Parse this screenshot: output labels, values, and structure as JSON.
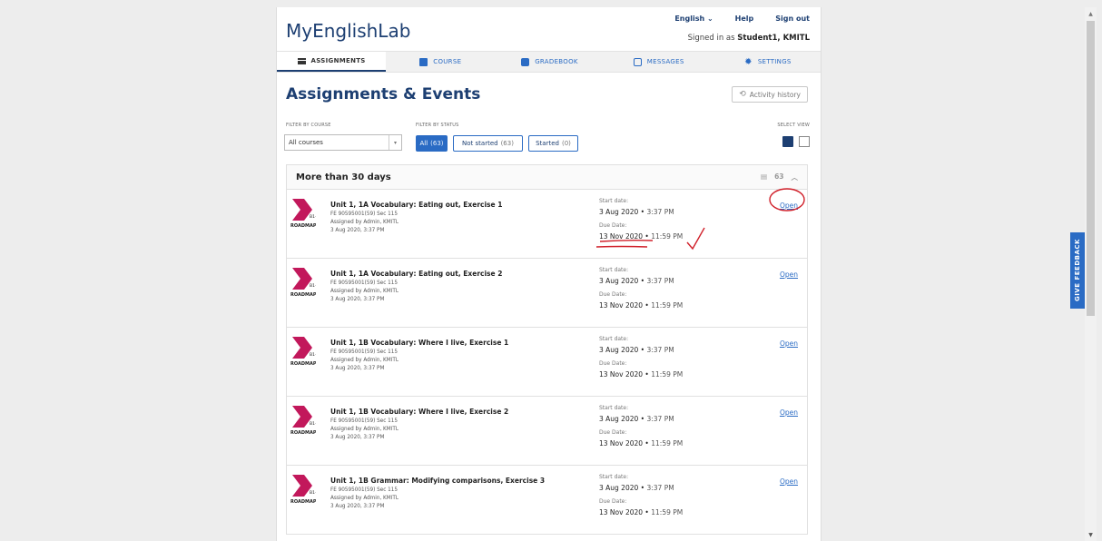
{
  "brand": "MyEnglishLab",
  "toplinks": {
    "language": "English",
    "help": "Help",
    "signout": "Sign out"
  },
  "signed_in": {
    "prefix": "Signed in as",
    "user": "Student1, KMITL"
  },
  "tabs": [
    {
      "label": "ASSIGNMENTS",
      "icon": "assignments-icon"
    },
    {
      "label": "COURSE",
      "icon": "book-icon"
    },
    {
      "label": "GRADEBOOK",
      "icon": "checkbox-icon"
    },
    {
      "label": "MESSAGES",
      "icon": "message-icon"
    },
    {
      "label": "SETTINGS",
      "icon": "gear-icon"
    }
  ],
  "heading": "Assignments & Events",
  "activity_button": "Activity history",
  "filters": {
    "course_label": "FILTER BY COURSE",
    "course_value": "All courses",
    "status_label": "FILTER BY STATUS",
    "view_label": "SELECT VIEW",
    "status_buttons": [
      {
        "label": "All",
        "count": "(63)"
      },
      {
        "label": "Not started",
        "count": "(63)"
      },
      {
        "label": "Started",
        "count": "(0)"
      }
    ]
  },
  "group": {
    "title": "More than 30 days",
    "count": "63"
  },
  "logo": {
    "level": "B1+",
    "brand": "ROADMAP",
    "color": "#c2185b"
  },
  "assignments": [
    {
      "title": "Unit 1, 1A Vocabulary: Eating out, Exercise 1",
      "course": "FE 90595001(59) Sec 115",
      "assigned_by": "Assigned by Admin, KMITL",
      "assigned_date": "3 Aug 2020, 3:37 PM",
      "start_label": "Start date:",
      "start_date": "3 Aug 2020",
      "start_time": "3:37 PM",
      "due_label": "Due Date:",
      "due_date": "13 Nov 2020",
      "due_time": "11:59 PM",
      "action": "Open"
    },
    {
      "title": "Unit 1, 1A Vocabulary: Eating out, Exercise 2",
      "course": "FE 90595001(59) Sec 115",
      "assigned_by": "Assigned by Admin, KMITL",
      "assigned_date": "3 Aug 2020, 3:37 PM",
      "start_label": "Start date:",
      "start_date": "3 Aug 2020",
      "start_time": "3:37 PM",
      "due_label": "Due Date:",
      "due_date": "13 Nov 2020",
      "due_time": "11:59 PM",
      "action": "Open"
    },
    {
      "title": "Unit 1, 1B Vocabulary: Where I live, Exercise 1",
      "course": "FE 90595001(59) Sec 115",
      "assigned_by": "Assigned by Admin, KMITL",
      "assigned_date": "3 Aug 2020, 3:37 PM",
      "start_label": "Start date:",
      "start_date": "3 Aug 2020",
      "start_time": "3:37 PM",
      "due_label": "Due Date:",
      "due_date": "13 Nov 2020",
      "due_time": "11:59 PM",
      "action": "Open"
    },
    {
      "title": "Unit 1, 1B Vocabulary: Where I live, Exercise 2",
      "course": "FE 90595001(59) Sec 115",
      "assigned_by": "Assigned by Admin, KMITL",
      "assigned_date": "3 Aug 2020, 3:37 PM",
      "start_label": "Start date:",
      "start_date": "3 Aug 2020",
      "start_time": "3:37 PM",
      "due_label": "Due Date:",
      "due_date": "13 Nov 2020",
      "due_time": "11:59 PM",
      "action": "Open"
    },
    {
      "title": "Unit 1, 1B Grammar: Modifying comparisons, Exercise 3",
      "course": "FE 90595001(59) Sec 115",
      "assigned_by": "Assigned by Admin, KMITL",
      "assigned_date": "3 Aug 2020, 3:37 PM",
      "start_label": "Start date:",
      "start_date": "3 Aug 2020",
      "start_time": "3:37 PM",
      "due_label": "Due Date:",
      "due_date": "13 Nov 2020",
      "due_time": "11:59 PM",
      "action": "Open"
    }
  ],
  "feedback": "GIVE FEEDBACK"
}
